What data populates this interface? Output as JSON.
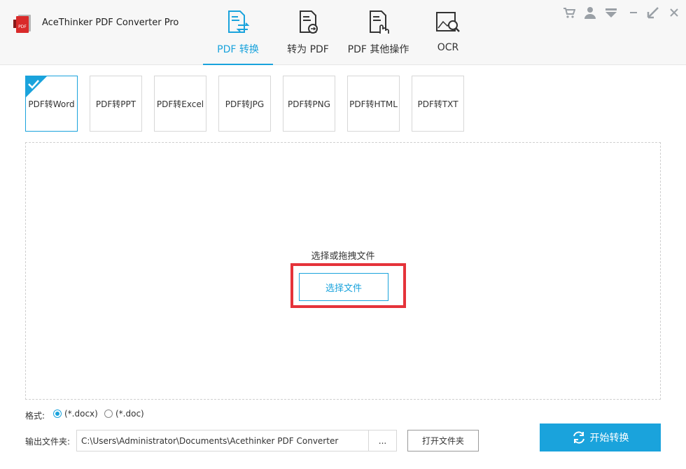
{
  "app": {
    "title": "AceThinker PDF Converter Pro",
    "logo_icon": "pdf-logo-icon"
  },
  "nav": {
    "tabs": [
      {
        "label": "PDF 转换",
        "icon": "pdf-convert-icon",
        "active": true
      },
      {
        "label": "转为 PDF",
        "icon": "to-pdf-icon",
        "active": false
      },
      {
        "label": "PDF 其他操作",
        "icon": "pdf-tools-icon",
        "active": false
      },
      {
        "label": "OCR",
        "icon": "ocr-icon",
        "active": false
      }
    ]
  },
  "window_controls": [
    "cart-icon",
    "user-icon",
    "menu-icon",
    "minimize-icon",
    "maximize-icon",
    "close-icon"
  ],
  "formats": {
    "selected": 0,
    "items": [
      {
        "label": "PDF转Word"
      },
      {
        "label": "PDF转PPT"
      },
      {
        "label": "PDF转Excel"
      },
      {
        "label": "PDF转JPG"
      },
      {
        "label": "PDF转PNG"
      },
      {
        "label": "PDF转HTML"
      },
      {
        "label": "PDF转TXT"
      }
    ]
  },
  "drop_zone": {
    "hint": "选择或拖拽文件",
    "button": "选择文件"
  },
  "options": {
    "format_label": "格式:",
    "radio_docx": "(*.docx)",
    "radio_doc": "(*.doc)",
    "selected": "docx"
  },
  "output": {
    "label": "输出文件夹:",
    "path": "C:\\Users\\Administrator\\Documents\\Acethinker PDF Converter",
    "browse": "...",
    "open_folder": "打开文件夹"
  },
  "start_button": "开始转换",
  "colors": {
    "accent": "#1aa3dc",
    "highlight": "#e5333a"
  }
}
